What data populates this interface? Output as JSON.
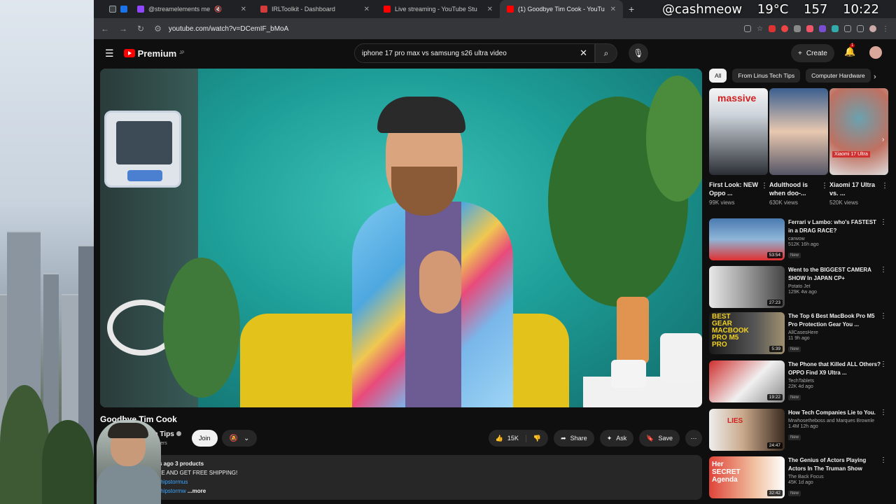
{
  "stream_overlay": {
    "handle": "@cashmeow",
    "temp": "19°C",
    "count": "157",
    "time": "10:22"
  },
  "browser": {
    "tabs": [
      {
        "label": ""
      },
      {
        "label": "@streamelements me"
      },
      {
        "label": "IRLToolkit - Dashboard"
      },
      {
        "label": "Live streaming - YouTube Stu"
      },
      {
        "label": "(1) Goodbye Tim Cook - YouTu"
      }
    ],
    "new_tab": "+",
    "url": "youtube.com/watch?v=DCemIF_bMoA"
  },
  "youtube_header": {
    "logo": "Premium",
    "logo_sup": "JP",
    "search_value": "iphone 17 pro max vs samsung s26 ultra video",
    "create": "Create",
    "notif_count": "1"
  },
  "video": {
    "title": "Goodbye Tim Cook",
    "channel": "Tech Tips",
    "subscribers": "subscribers",
    "join": "Join",
    "likes": "15K",
    "share": "Share",
    "ask": "Ask",
    "save": "Save",
    "desc_meta": "iews  8 hours ago  3 products",
    "desc_line2": "AT LTTSTORE AND GET FREE SHIPPING!",
    "desc_link1": "/shipstormus",
    "desc_link2": "/shipstormw",
    "desc_more": "...more"
  },
  "chips": [
    {
      "label": "All"
    },
    {
      "label": "From Linus Tech Tips"
    },
    {
      "label": "Computer Hardware"
    }
  ],
  "shorts": [
    {
      "title": "First Look: NEW Oppo ...",
      "views": "99K views",
      "thumb_text": "massive",
      "colors": [
        "#2b2f35",
        "#cfd5dc"
      ]
    },
    {
      "title": "Adulthood is when doo-...",
      "views": "630K views",
      "thumb_text": "",
      "colors": [
        "#3b5f8f",
        "#e8c8b0"
      ]
    },
    {
      "title": "Xiaomi 17 Ultra vs. ...",
      "views": "520K views",
      "thumb_text": "Xiaomi 17 Ultra",
      "colors": [
        "#6aa2b0",
        "#c07060"
      ]
    }
  ],
  "recommendations": [
    {
      "title": "Ferrari v Lambo: who's FASTEST in a DRAG RACE?",
      "channel": "carwow",
      "meta": "512K  16h ago",
      "new": "New",
      "duration": "53:54",
      "colors": [
        "#4a7ab0",
        "#e03030"
      ]
    },
    {
      "title": "Went to the BIGGEST CAMERA SHOW In JAPAN CP+",
      "channel": "Potato Jet",
      "meta": "129K  4w ago",
      "new": "",
      "duration": "27:23",
      "colors": [
        "#e8e8e8",
        "#444"
      ]
    },
    {
      "title": "The Top 6 Best MacBook Pro M5 Pro Protection Gear You ...",
      "channel": "AllCasesHere",
      "meta": "11  9h ago",
      "new": "New",
      "duration": "5:39",
      "colors": [
        "#1a1a1a",
        "#f0d020"
      ]
    },
    {
      "title": "The Phone that Killed ALL Others? OPPO Find X9 Ultra ...",
      "channel": "TechTablets",
      "meta": "22K  4d ago",
      "new": "New",
      "duration": "19:22",
      "colors": [
        "#d03030",
        "#f0f0f0"
      ]
    },
    {
      "title": "How Tech Companies Lie to You.",
      "channel": "Mrwhosetheboss",
      "channel2": "and Marques Brownle",
      "meta": "1.4M  12h ago",
      "new": "New",
      "duration": "24:47",
      "colors": [
        "#eeeeee",
        "#d02020"
      ]
    },
    {
      "title": "The Genius of Actors Playing Actors In The Truman Show",
      "channel": "The Back Focus",
      "meta": "45K  1d ago",
      "new": "New",
      "duration": "32:42",
      "colors": [
        "#e0443a",
        "#f0c0a0"
      ]
    }
  ],
  "rec_thumb_texts": [
    "",
    "",
    "BEST GEAR MACBOOK PRO M5 PRO",
    "",
    "LIES",
    "Her SECRET Agenda"
  ]
}
